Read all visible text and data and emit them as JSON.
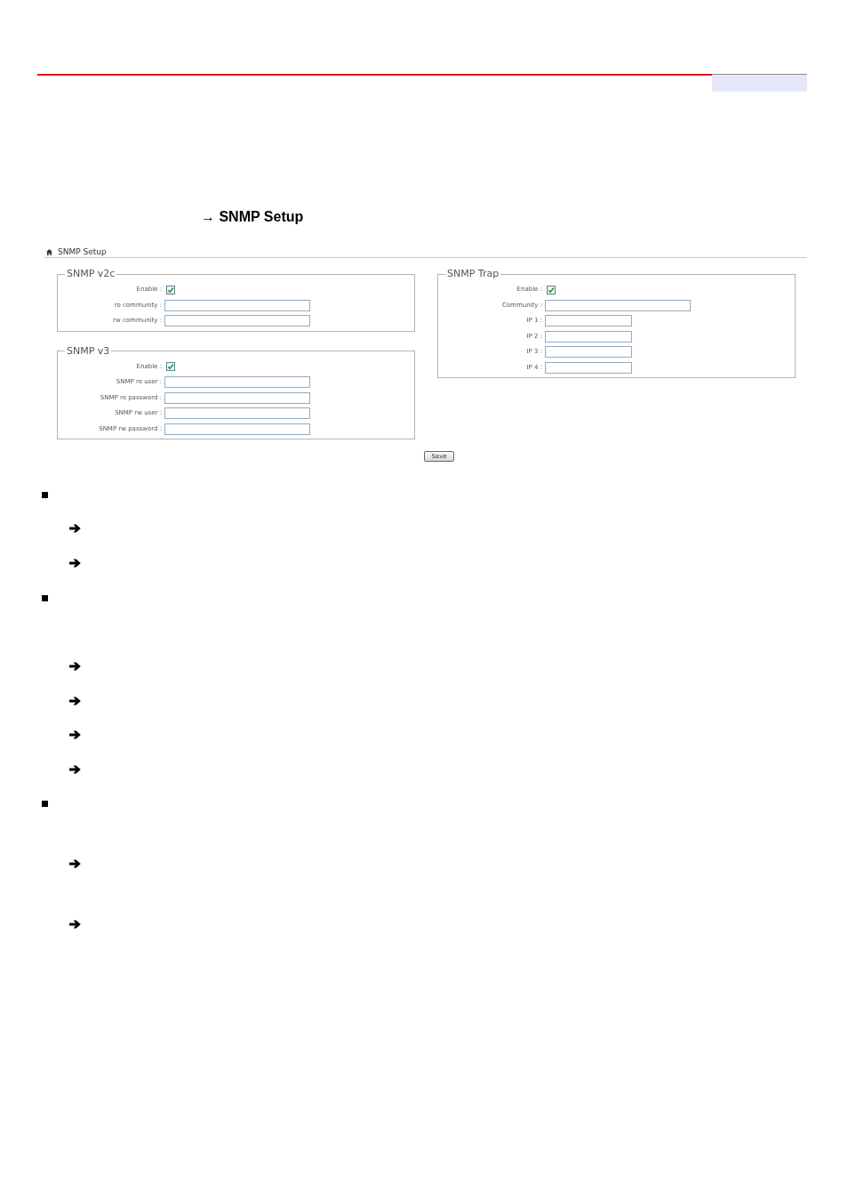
{
  "heading": "→ SNMP Setup",
  "breadcrumb": "SNMP Setup",
  "left_column": [
    {
      "title": "SNMP v2c",
      "fields": [
        {
          "kind": "checkbox",
          "label": "Enable :",
          "checked": true
        },
        {
          "kind": "text",
          "label": "ro community :"
        },
        {
          "kind": "text",
          "label": "rw community :"
        }
      ]
    },
    {
      "title": "SNMP v3",
      "fields": [
        {
          "kind": "checkbox",
          "label": "Enable :",
          "checked": true
        },
        {
          "kind": "text",
          "label": "SNMP ro user :"
        },
        {
          "kind": "text",
          "label": "SNMP ro password :"
        },
        {
          "kind": "text",
          "label": "SNMP rw user :"
        },
        {
          "kind": "text",
          "label": "SNMP rw password :"
        }
      ]
    }
  ],
  "right_column": [
    {
      "title": "SNMP Trap",
      "fields": [
        {
          "kind": "checkbox",
          "label": "Enable :",
          "checked": true
        },
        {
          "kind": "text",
          "label": "Community :"
        },
        {
          "kind": "ip",
          "label": "IP 1 :"
        },
        {
          "kind": "ip",
          "label": "IP 2 :"
        },
        {
          "kind": "ip",
          "label": "IP 3 :"
        },
        {
          "kind": "ip",
          "label": "IP 4 :"
        }
      ]
    }
  ],
  "save_button": "Save"
}
